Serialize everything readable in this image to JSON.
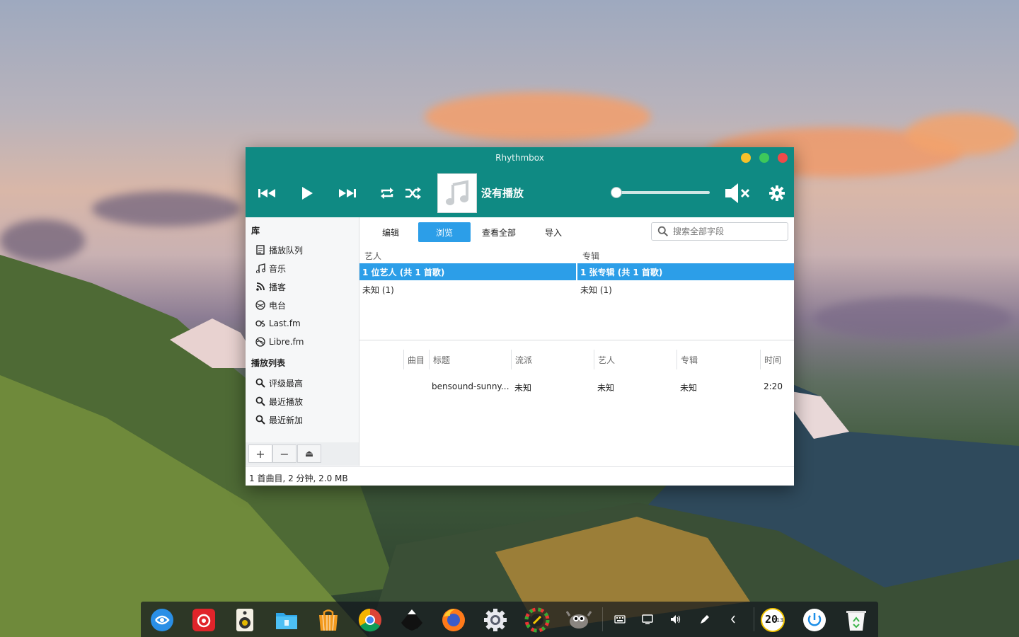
{
  "window": {
    "title": "Rhythmbox",
    "now_playing": "没有播放",
    "volume_level": 0.0
  },
  "sidebar": {
    "library_header": "库",
    "library_items": [
      {
        "label": "播放队列",
        "icon": "queue-icon"
      },
      {
        "label": "音乐",
        "icon": "music-note-icon"
      },
      {
        "label": "播客",
        "icon": "rss-icon"
      },
      {
        "label": "电台",
        "icon": "radio-icon"
      },
      {
        "label": "Last.fm",
        "icon": "lastfm-icon"
      },
      {
        "label": "Libre.fm",
        "icon": "librefm-icon"
      }
    ],
    "playlists_header": "播放列表",
    "playlist_items": [
      {
        "label": "评级最高",
        "icon": "search-icon"
      },
      {
        "label": "最近播放",
        "icon": "search-icon"
      },
      {
        "label": "最近新加",
        "icon": "search-icon"
      }
    ],
    "add_label": "+",
    "remove_label": "−",
    "eject_label": "⏏"
  },
  "tabs": [
    {
      "label": "编辑",
      "active": false
    },
    {
      "label": "浏览",
      "active": true
    },
    {
      "label": "查看全部",
      "active": false
    },
    {
      "label": "导入",
      "active": false
    }
  ],
  "search": {
    "placeholder": "搜索全部字段"
  },
  "browser": {
    "artist_header": "艺人",
    "album_header": "专辑",
    "artist_selected": "1 位艺人 (共 1 首歌)",
    "album_selected": "1 张专辑 (共 1 首歌)",
    "artist_row": "未知 (1)",
    "album_row": "未知 (1)"
  },
  "tracklist": {
    "columns": [
      "曲目",
      "标题",
      "流派",
      "艺人",
      "专辑",
      "时间"
    ],
    "rows": [
      {
        "track": "",
        "title": "bensound-sunny.…",
        "genre": "未知",
        "artist": "未知",
        "album": "未知",
        "time": "2:20"
      }
    ]
  },
  "status": "1 首曲目, 2 分钟, 2.0 MB",
  "dock": {
    "apps": [
      "deepin-launcher-icon",
      "netease-music-icon",
      "deepin-music-icon",
      "file-manager-icon",
      "app-store-icon",
      "chrome-icon",
      "inkscape-icon",
      "firefox-icon",
      "settings-icon",
      "color-picker-icon",
      "gimp-icon"
    ],
    "tray": [
      "keyboard-icon",
      "screen-icon",
      "volume-icon",
      "pen-icon",
      "chevron-left-icon"
    ],
    "clock_text": "20",
    "clock_sub": "13"
  },
  "colors": {
    "accent": "#0f8a83",
    "selection": "#2c9ee8"
  }
}
